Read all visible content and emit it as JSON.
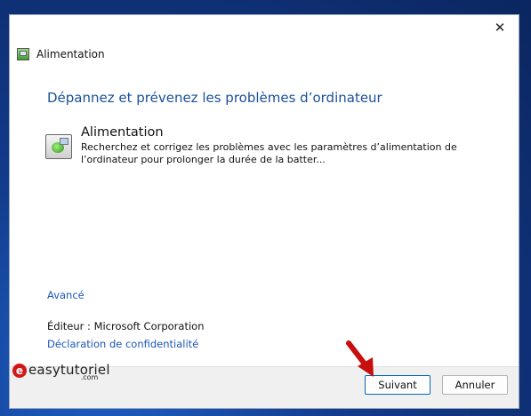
{
  "window": {
    "title": "Alimentation",
    "close_glyph": "✕"
  },
  "heading": "Dépannez et prévenez les problèmes d’ordinateur",
  "item": {
    "title": "Alimentation",
    "description": "Recherchez et corrigez les problèmes avec les paramètres d’alimentation de l’ordinateur pour prolonger la durée de la batter..."
  },
  "advanced_link": "Avancé",
  "publisher": {
    "label": "Éditeur :",
    "value": "Microsoft Corporation"
  },
  "privacy_link": "Déclaration de confidentialité",
  "buttons": {
    "next": "Suivant",
    "cancel": "Annuler"
  },
  "watermark": {
    "logo_letter": "e",
    "text": "easytutoriel",
    "suffix": ".com"
  },
  "colors": {
    "heading": "#1b4f9c",
    "link": "#1a57b8",
    "arrow": "#c80e0e"
  }
}
